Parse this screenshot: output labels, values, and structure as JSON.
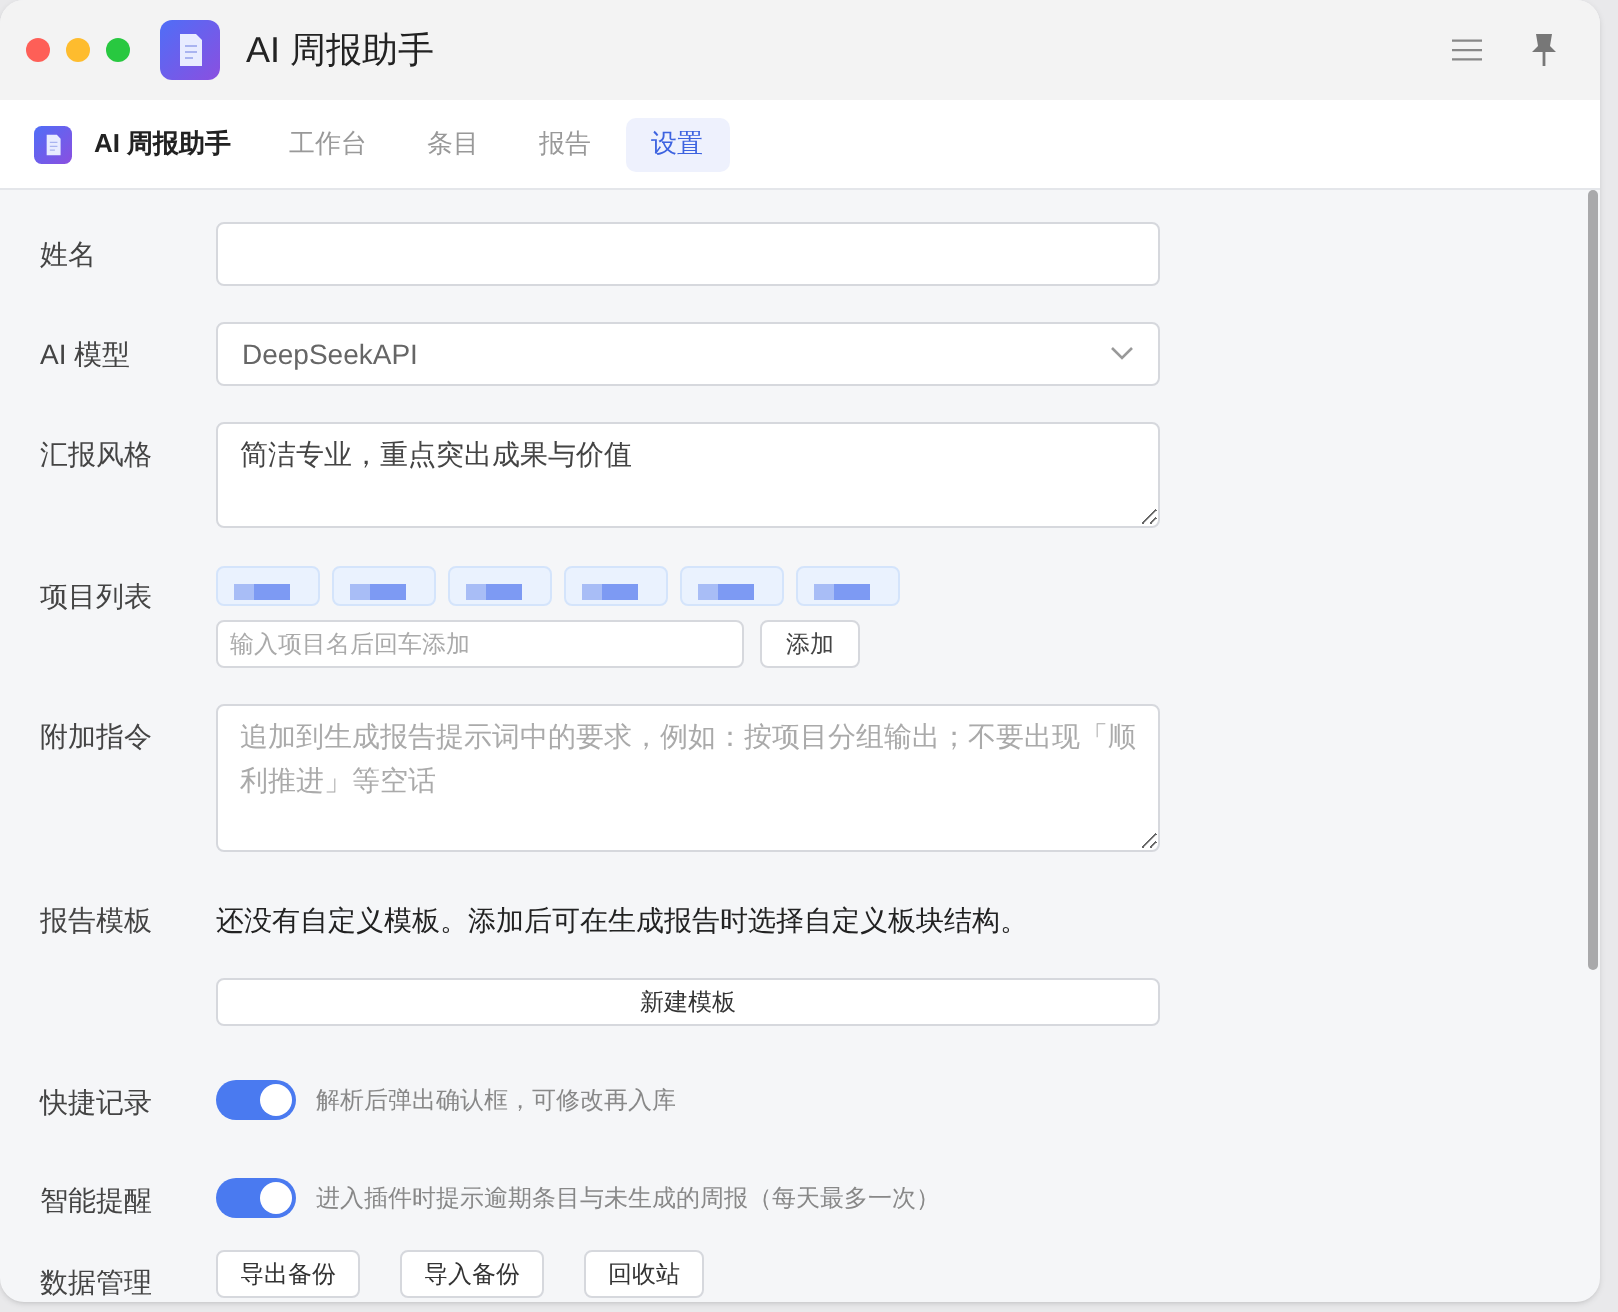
{
  "window": {
    "title": "AI 周报助手"
  },
  "nav": {
    "brand": "AI 周报助手",
    "tabs": [
      {
        "label": "工作台",
        "selected": false
      },
      {
        "label": "条目",
        "selected": false
      },
      {
        "label": "报告",
        "selected": false
      },
      {
        "label": "设置",
        "selected": true
      }
    ]
  },
  "settings": [
    {
      "kind": "input",
      "label": "姓名"
    },
    {
      "kind": "select",
      "label": "AI 模型",
      "value": "DeepSeekAPI"
    },
    {
      "kind": "textarea",
      "label": "汇报风格",
      "value": "简洁专业，重点突出成果与价值"
    },
    {
      "kind": "tags",
      "label": "项目列表",
      "tags": [
        {
          "kind": "redacted"
        },
        {
          "kind": "redacted"
        },
        {
          "kind": "redacted"
        },
        {
          "kind": "redacted"
        },
        {
          "kind": "redacted"
        },
        {
          "kind": "redacted"
        }
      ],
      "placeholder": "输入项目名后回车添加",
      "button": "添加"
    },
    {
      "kind": "textarea",
      "label": "附加指令",
      "placeholder": "追加到生成报告提示词中的要求，例如：按项目分组输出；不要出现「顺利推进」等空话"
    },
    {
      "kind": "template",
      "label": "报告模板",
      "text": "还没有自定义模板。添加后可在生成报告时选择自定义板块结构。",
      "button": "新建模板"
    },
    {
      "kind": "toggle",
      "label": "快捷记录",
      "on": true,
      "hint": "解析后弹出确认框，可修改再入库"
    },
    {
      "kind": "toggle",
      "label": "智能提醒",
      "on": true,
      "hint": "进入插件时提示逾期条目与未生成的周报（每天最多一次）"
    },
    {
      "kind": "buttons",
      "label": "数据管理",
      "buttons": [
        "导出备份",
        "导入备份",
        "回收站"
      ]
    }
  ]
}
